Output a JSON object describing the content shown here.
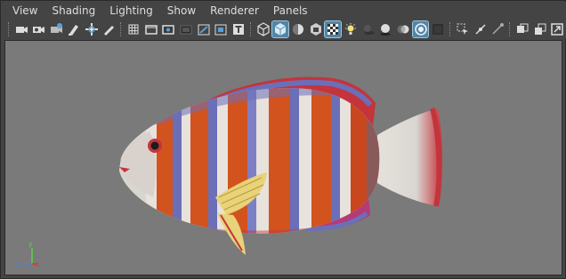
{
  "menubar": {
    "items": [
      "View",
      "Shading",
      "Lighting",
      "Show",
      "Renderer",
      "Panels"
    ]
  },
  "toolbar": {
    "groups": [
      [
        "camera-icon",
        "camera-attributes-icon",
        "bookmark-camera-icon",
        "image-plane-icon",
        "2d-pan-zoom-icon",
        "grease-pencil-icon"
      ],
      [
        "grid-icon",
        "film-gate-icon",
        "resolution-gate-icon",
        "gate-mask-icon",
        "field-chart-icon",
        "safe-action-icon",
        "safe-title-icon"
      ],
      [
        "wireframe-icon",
        "smooth-shade-icon",
        "default-material-icon",
        "xray-icon",
        "textured-icon",
        "use-all-lights-icon",
        "shadows-icon",
        "screen-space-ao-icon",
        "motion-blur-icon",
        "multisample-aa-icon",
        "depth-of-field-icon"
      ],
      [
        "isolate-select-icon",
        "xray-joints-icon",
        "xray-active-components-icon"
      ],
      [
        "two-pane-icon",
        "four-pane-icon",
        "maximize-pane-icon"
      ]
    ],
    "active": [
      "smooth-shade-icon",
      "textured-icon",
      "multisample-aa-icon"
    ]
  },
  "viewport": {
    "background": "#7a7a7a",
    "axis": {
      "x": "x",
      "y": "y",
      "z": "z",
      "x_color": "#d23c3c",
      "y_color": "#5fd14a",
      "z_color": "#4a7fe0"
    }
  },
  "colors": {
    "fish_orange": "#d2531e",
    "fish_blue": "#6b6fb8",
    "fish_white": "#e7e2dc",
    "fish_red": "#c4343b",
    "fin_yellow": "#e8d27a"
  }
}
